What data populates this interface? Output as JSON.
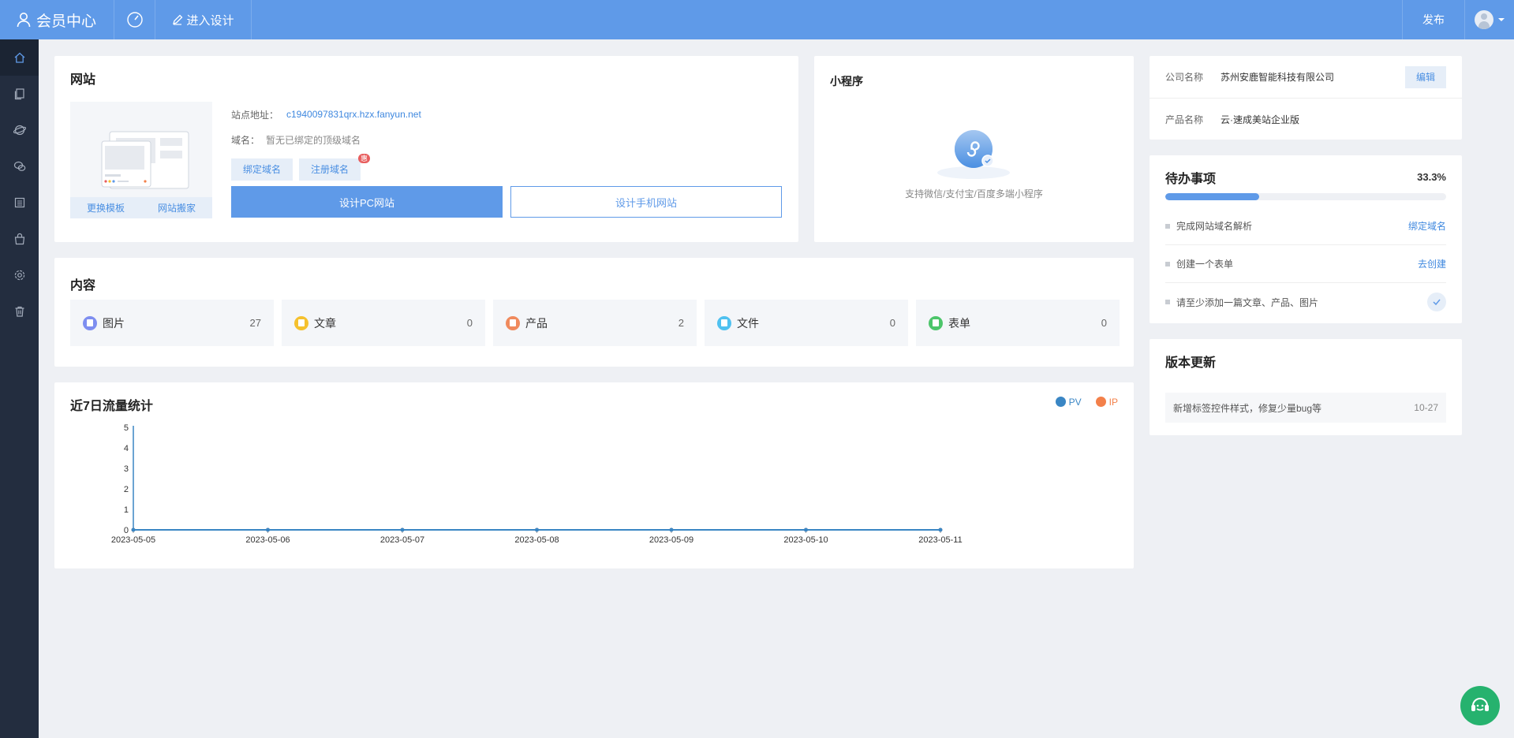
{
  "header": {
    "brand": "会员中心",
    "design_label": "进入设计",
    "publish_label": "发布"
  },
  "sidebar": {
    "items": [
      {
        "icon": "home-icon",
        "active": true
      },
      {
        "icon": "pages-icon"
      },
      {
        "icon": "globe-icon"
      },
      {
        "icon": "wechat-icon"
      },
      {
        "icon": "list-icon"
      },
      {
        "icon": "bag-icon"
      },
      {
        "icon": "settings-icon"
      },
      {
        "icon": "trash-icon"
      }
    ]
  },
  "website": {
    "title": "网站",
    "site_addr_label": "站点地址：",
    "site_addr": "c1940097831qrx.hzx.fanyun.net",
    "domain_label": "域名：",
    "domain_value": "暂无已绑定的顶级域名",
    "bind_domain": "绑定域名",
    "register_domain": "注册域名",
    "register_badge": "惠",
    "change_template": "更换模板",
    "site_move": "网站搬家",
    "design_pc": "设计PC网站",
    "design_mobile": "设计手机网站"
  },
  "mini_program": {
    "title": "小程序",
    "desc": "支持微信/支付宝/百度多端小程序"
  },
  "content": {
    "title": "内容",
    "items": [
      {
        "label": "图片",
        "count": "27",
        "color": "#7e8ef0"
      },
      {
        "label": "文章",
        "count": "0",
        "color": "#f5c12e"
      },
      {
        "label": "产品",
        "count": "2",
        "color": "#f08a5d"
      },
      {
        "label": "文件",
        "count": "0",
        "color": "#4fc1f0"
      },
      {
        "label": "表单",
        "count": "0",
        "color": "#4cc56a"
      }
    ]
  },
  "traffic": {
    "title": "近7日流量统计",
    "legend_pv": "PV",
    "legend_ip": "IP"
  },
  "chart_data": {
    "type": "line",
    "title": "近7日流量统计",
    "x": [
      "2023-05-05",
      "2023-05-06",
      "2023-05-07",
      "2023-05-08",
      "2023-05-09",
      "2023-05-10",
      "2023-05-11"
    ],
    "series": [
      {
        "name": "PV",
        "values": [
          0,
          0,
          0,
          0,
          0,
          0,
          0
        ],
        "color": "#3a86c4"
      },
      {
        "name": "IP",
        "values": [
          0,
          0,
          0,
          0,
          0,
          0,
          0
        ],
        "color": "#f3804a"
      }
    ],
    "yticks": [
      "0",
      "1",
      "2",
      "3",
      "4",
      "5"
    ],
    "ylim": [
      0,
      5
    ],
    "legend": "top-right"
  },
  "company": {
    "name_label": "公司名称",
    "name_value": "苏州安鹿智能科技有限公司",
    "edit_label": "编辑",
    "product_label": "产品名称",
    "product_value": "云·速成美站企业版"
  },
  "todo": {
    "title": "待办事项",
    "percent": "33.3%",
    "progress": 0.333,
    "items": [
      {
        "text": "完成网站域名解析",
        "action": "绑定域名"
      },
      {
        "text": "创建一个表单",
        "action": "去创建"
      },
      {
        "text": "请至少添加一篇文章、产品、图片",
        "done": true
      }
    ]
  },
  "version": {
    "title": "版本更新",
    "item_text": "新增标签控件样式，修复少量bug等",
    "item_date": "10-27"
  }
}
